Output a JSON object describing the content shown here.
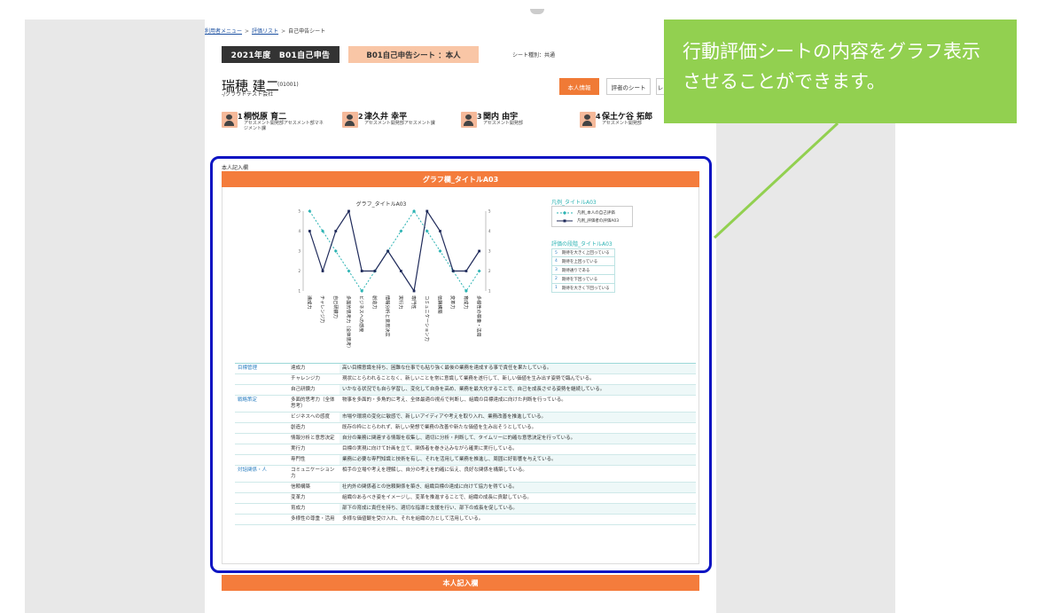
{
  "breadcrumb": {
    "items": [
      "利用者メニュー",
      "評価リスト",
      "自己申告シート"
    ],
    "sep": ">"
  },
  "header": {
    "year_title": "2021年度　B01自己申告",
    "sheet_title": "B01自己申告シート ：本人",
    "sheet_type": "シート種別：共通"
  },
  "person": {
    "name": "瑞穂 建二",
    "id": "(01001)",
    "org": "-/クラウドテスト会社"
  },
  "buttons": {
    "self": "本人情報",
    "other": "評者のシート",
    "more": "レ"
  },
  "evaluators": [
    {
      "num": "1",
      "name": "桐悦原 育二",
      "role": "アセスメント開発部アセスメント部マネジメント課"
    },
    {
      "num": "2",
      "name": "津久井 幸平",
      "role": "アセスメント開発部アセスメント課"
    },
    {
      "num": "3",
      "name": "関内 由宇",
      "role": "アセスメント開発部"
    },
    {
      "num": "4",
      "name": "保土ケ谷 拓郎",
      "role": "アセスメント開発部"
    }
  ],
  "section": {
    "label": "本人記入欄",
    "graph_header": "グラフ欄_タイトルA03",
    "next_header": "本人記入欄"
  },
  "legend": {
    "title": "凡例_タイトルA03",
    "items": [
      "凡例_本人の自己評価",
      "凡例_評価者の評価A03"
    ]
  },
  "scale": {
    "title": "評価の段階_タイトルA03",
    "rows": [
      {
        "n": "5",
        "label": "期待を大きく上回っている"
      },
      {
        "n": "4",
        "label": "期待を上回っている"
      },
      {
        "n": "3",
        "label": "期待通りである"
      },
      {
        "n": "2",
        "label": "期待を下回っている"
      },
      {
        "n": "1",
        "label": "期待を大きく下回っている"
      }
    ]
  },
  "competencies": [
    {
      "cat": "目標管理",
      "name": "達成力",
      "desc": "高い目標意識を持ち、困難な仕事でも粘り強く最後の業務を達成する事で責任を果たしている。"
    },
    {
      "cat": "",
      "name": "チャレンジ力",
      "desc": "現状にとらわれることなく、新しいことを常に意識して業務を遂行して、新しい価値を生み出す姿勢で臨んでいる。"
    },
    {
      "cat": "",
      "name": "自己研鑽力",
      "desc": "いかなる状況でも自ら学習し、変化して自身を高め、業務を最大化することで、自己を成長させる姿勢を継続している。"
    },
    {
      "cat": "戦略策定",
      "name": "多面的思考力（全体思考）",
      "desc": "物事を多面的・多角的に考え、全体最適の視点で判断し、組織の目標達成に向けた判断を行っている。"
    },
    {
      "cat": "",
      "name": "ビジネスへの感度",
      "desc": "市場や環境の変化に敏感で、新しいアイディアや考えを取り入れ、業務改善を推進している。"
    },
    {
      "cat": "",
      "name": "創造力",
      "desc": "既存の枠にとらわれず、新しい発想で業務の改善や新たな価値を生み出そうとしている。"
    },
    {
      "cat": "",
      "name": "情報分析と意思決定",
      "desc": "自分の業務に関連する情報を収集し、適切に分析・判断して、タイムリーに的確な意思決定を行っている。"
    },
    {
      "cat": "",
      "name": "実行力",
      "desc": "目標の実現に向けて計画を立て、関係者を巻き込みながら確実に実行している。"
    },
    {
      "cat": "",
      "name": "専門性",
      "desc": "業務に必要な専門知識と技術を有し、それを活用して業務を推進し、周囲に好影響を与えている。"
    },
    {
      "cat": "対話関係・人",
      "name": "コミュニケーション力",
      "desc": "相手の立場や考えを理解し、自分の考えを的確に伝え、良好な関係を構築している。"
    },
    {
      "cat": "",
      "name": "信頼構築",
      "desc": "社内外の関係者との信頼関係を築き、組織目標の達成に向けて協力を得ている。"
    },
    {
      "cat": "",
      "name": "変革力",
      "desc": "組織のあるべき姿をイメージし、変革を推進することで、組織の成長に貢献している。"
    },
    {
      "cat": "",
      "name": "育成力",
      "desc": "部下の育成に責任を持ち、適切な指導と支援を行い、部下の成長を促している。"
    },
    {
      "cat": "",
      "name": "多様性の尊重・活用",
      "desc": "多様な価値観を受け入れ、それを組織の力として活用している。"
    }
  ],
  "chart_data": {
    "type": "line",
    "title": "グラフ_タイトルA03",
    "categories": [
      "達成力",
      "チャレンジ力",
      "自己研鑽力",
      "多面的思考力（全体思考）",
      "ビジネスへの感度",
      "創造力",
      "情報分析と意思決定",
      "実行力",
      "専門性",
      "コミュニケーション力",
      "信頼構築",
      "変革力",
      "育成力",
      "多様性の尊重・活用"
    ],
    "series": [
      {
        "name": "凡例_本人の自己評価",
        "values": [
          5,
          4,
          3,
          2,
          1,
          2,
          3,
          4,
          5,
          4,
          3,
          2,
          1,
          2
        ],
        "color": "#2bb3b3",
        "dashed": true
      },
      {
        "name": "凡例_評価者の評価A03",
        "values": [
          4,
          2,
          4,
          5,
          2,
          2,
          3,
          2,
          1,
          5,
          4,
          2,
          2,
          3
        ],
        "color": "#1f2a5a",
        "dashed": false
      }
    ],
    "ylim": [
      1,
      5
    ],
    "yticks": [
      1,
      2,
      3,
      4,
      5
    ],
    "grid": false
  },
  "callout": {
    "lines": [
      "行動評価シートの内容をグラフ表示",
      "させることができます。"
    ],
    "color": "#92d050"
  }
}
